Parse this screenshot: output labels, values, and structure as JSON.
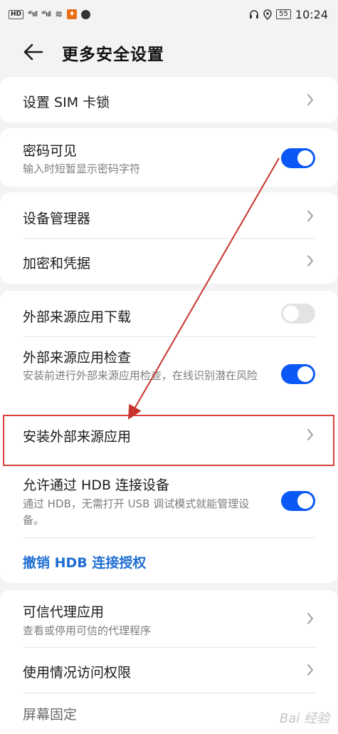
{
  "status_bar": {
    "hd": "HD",
    "signal1": "⁴⁶ııll",
    "signal2": "⁴⁶ııll",
    "wifi": "≋",
    "battery": "55",
    "time": "10:24"
  },
  "header": {
    "title": "更多安全设置"
  },
  "card1": {
    "sim_lock": "设置 SIM 卡锁"
  },
  "card2": {
    "password_visible": {
      "title": "密码可见",
      "subtitle": "输入时短暂显示密码字符",
      "on": true
    }
  },
  "card3": {
    "device_admin": "设备管理器",
    "encryption": "加密和凭据"
  },
  "card4": {
    "external_download": {
      "title": "外部来源应用下载",
      "on": false
    },
    "external_check": {
      "title": "外部来源应用检查",
      "subtitle": "安装前进行外部来源应用检查，在线识别潜在风险",
      "on": true
    },
    "install_external": "安装外部来源应用",
    "hdb": {
      "title": "允许通过 HDB 连接设备",
      "subtitle": "通过 HDB，无需打开 USB 调试模式就能管理设备。",
      "on": true
    },
    "revoke_hdb": "撤销 HDB 连接授权"
  },
  "card5": {
    "trusted_agents": {
      "title": "可信代理应用",
      "subtitle": "查看或停用可信的代理程序"
    },
    "usage_access": "使用情况访问权限",
    "screen_pinning": "屏幕固定"
  },
  "watermark": "Bai 经验",
  "colors": {
    "accent": "#0a59f7",
    "link": "#1f6fd1",
    "highlight": "#d9413a"
  }
}
